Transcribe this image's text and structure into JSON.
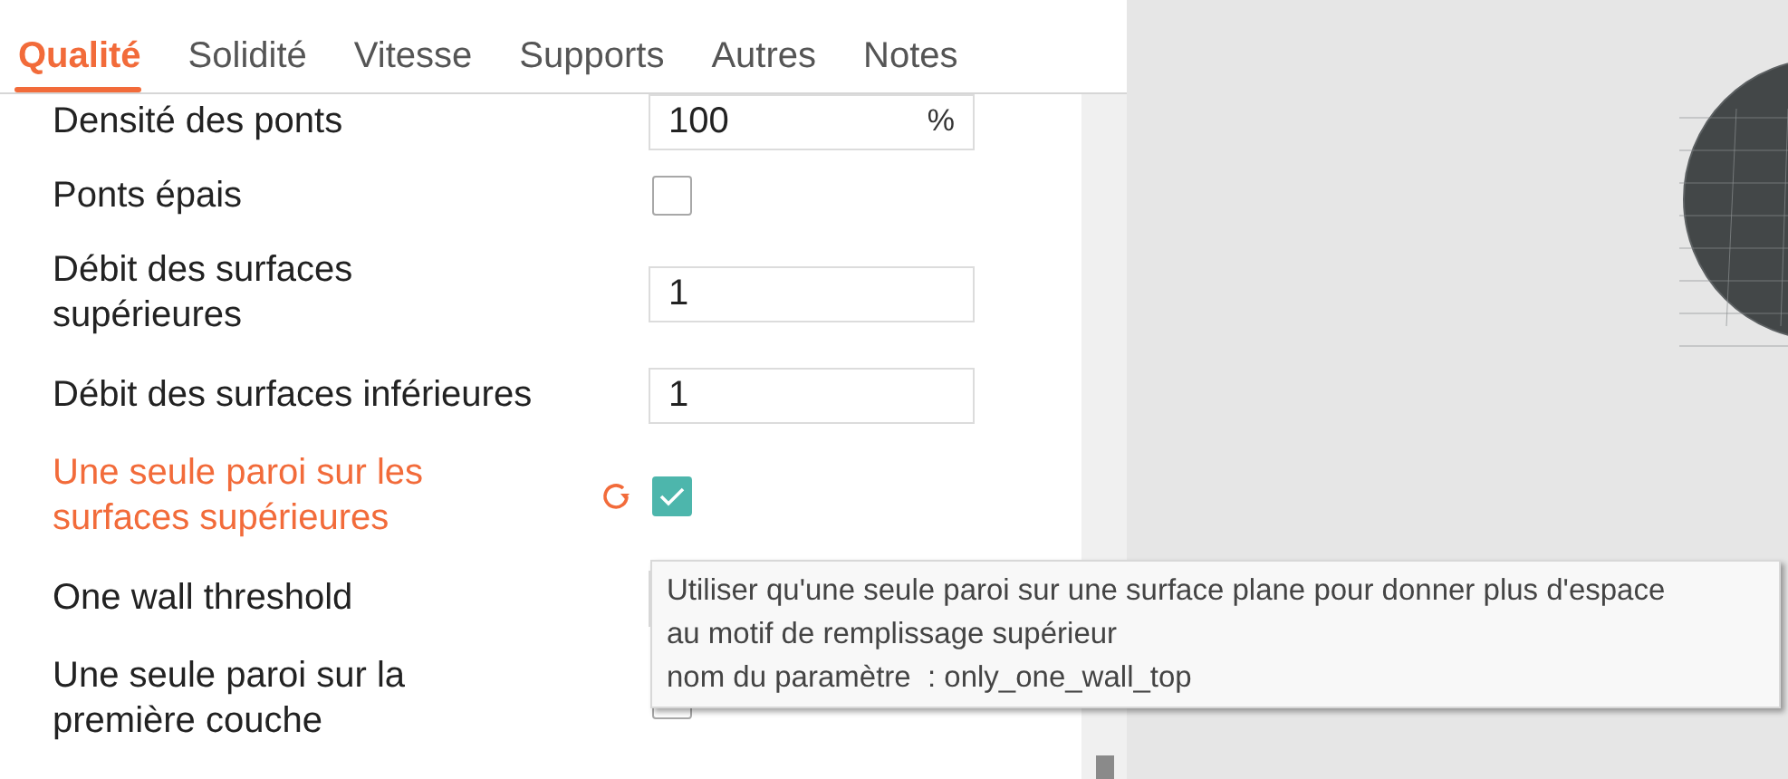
{
  "tabs": [
    {
      "label": "Qualité",
      "selected": true
    },
    {
      "label": "Solidité",
      "selected": false
    },
    {
      "label": "Vitesse",
      "selected": false
    },
    {
      "label": "Supports",
      "selected": false
    },
    {
      "label": "Autres",
      "selected": false
    },
    {
      "label": "Notes",
      "selected": false
    }
  ],
  "settings": [
    {
      "kind": "field",
      "label": "Densité des ponts",
      "value": "100",
      "unit": "%",
      "modified": false
    },
    {
      "kind": "checkbox",
      "label": "Ponts épais",
      "checked": false,
      "modified": false
    },
    {
      "kind": "field",
      "label": "Débit des surfaces supérieures",
      "value": "1",
      "modified": false
    },
    {
      "kind": "field",
      "label": "Débit des surfaces inférieures",
      "value": "1",
      "modified": false
    },
    {
      "kind": "checkbox",
      "label": "Une seule paroi sur les surfaces supérieures",
      "checked": true,
      "modified": true
    },
    {
      "kind": "field",
      "label": "One wall threshold",
      "modified": false
    },
    {
      "kind": "checkbox",
      "label": "Une seule paroi sur la première couche",
      "checked": false,
      "modified": false
    }
  ],
  "tooltip": {
    "lines": [
      "Utiliser qu'une seule paroi sur une surface plane pour donner plus d'espace",
      "au motif de remplissage supérieur",
      "nom du paramètre  : only_one_wall_top"
    ]
  }
}
